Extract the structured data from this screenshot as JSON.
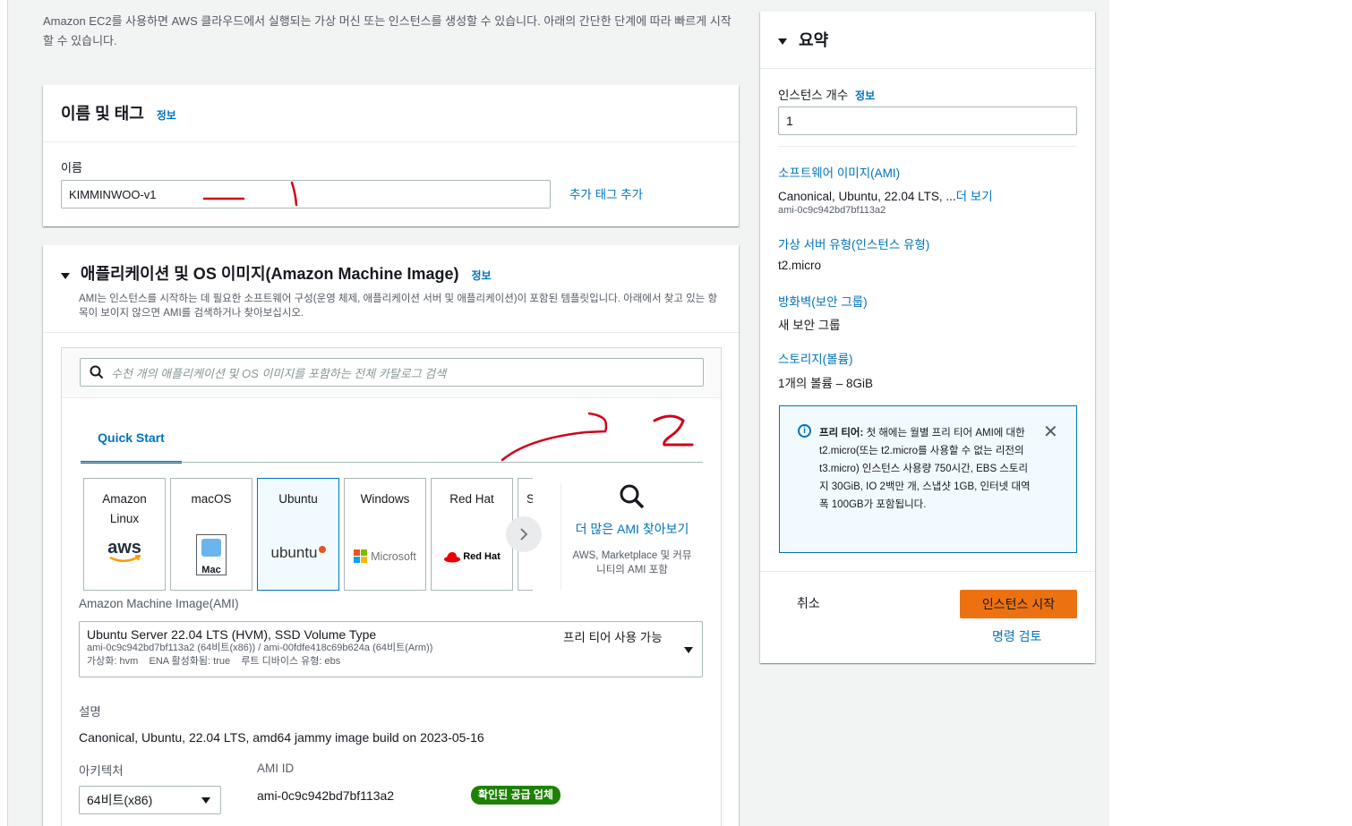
{
  "page": {
    "description": "Amazon EC2를 사용하면 AWS 클라우드에서 실행되는 가상 머신 또는 인스턴스를 생성할 수 있습니다. 아래의 간단한 단계에 따라 빠르게 시작할 수 있습니다."
  },
  "name_tags": {
    "title": "이름 및 태그",
    "info": "정보",
    "name_label": "이름",
    "name_value": "KIMMINWOO-v1",
    "add_tag": "추가 태그 추가"
  },
  "ami": {
    "title": "애플리케이션 및 OS 이미지(Amazon Machine Image)",
    "info": "정보",
    "description": "AMI는 인스턴스를 시작하는 데 필요한 소프트웨어 구성(운영 체제, 애플리케이션 서버 및 애플리케이션)이 포함된 템플릿입니다. 아래에서 찾고 있는 항목이 보이지 않으면 AMI를 검색하거나 찾아보십시오.",
    "search_placeholder": "수천 개의 애플리케이션 및 OS 이미지를 포함하는 전체 카탈로그 검색",
    "tab": "Quick Start",
    "os_cards": [
      {
        "label": "Amazon Linux",
        "logo": "aws"
      },
      {
        "label": "macOS",
        "logo": "Mac"
      },
      {
        "label": "Ubuntu",
        "logo": "ubuntu"
      },
      {
        "label": "Windows",
        "logo": "Microsoft"
      },
      {
        "label": "Red Hat",
        "logo": "Red Hat"
      },
      {
        "label": "S"
      }
    ],
    "more_title": "더 많은 AMI 찾아보기",
    "more_sub": "AWS, Marketplace 및 커뮤니티의 AMI 포함",
    "ami_label": "Amazon Machine Image(AMI)",
    "selected_name": "Ubuntu Server 22.04 LTS (HVM), SSD Volume Type",
    "selected_free": "프리 티어 사용 가능",
    "selected_ids": "ami-0c9c942bd7bf113a2 (64비트(x86)) / ami-00fdfe418c69b624a (64비트(Arm))",
    "selected_meta": "가상화: hvm    ENA 활성화됨: true    루트 디바이스 유형: ebs",
    "desc_label": "설명",
    "desc_value": "Canonical, Ubuntu, 22.04 LTS, amd64 jammy image build on 2023-05-16",
    "arch_label": "아키텍처",
    "arch_value": "64비트(x86)",
    "ami_id_label": "AMI ID",
    "ami_id_value": "ami-0c9c942bd7bf113a2",
    "verified_badge": "확인된 공급 업체"
  },
  "summary": {
    "title": "요약",
    "count_label": "인스턴스 개수",
    "info": "정보",
    "count_value": "1",
    "software_image_label": "소프트웨어 이미지(AMI)",
    "software_image_value": "Canonical, Ubuntu, 22.04 LTS, ...",
    "more_link": "더 보기",
    "software_image_id": "ami-0c9c942bd7bf113a2",
    "instance_type_label": "가상 서버 유형(인스턴스 유형)",
    "instance_type_value": "t2.micro",
    "firewall_label": "방화벽(보안 그룹)",
    "firewall_value": "새 보안 그룹",
    "storage_label": "스토리지(볼륨)",
    "storage_value": "1개의 볼륨 – 8GiB",
    "free_tier_text_bold": "프리 티어:",
    "free_tier_text": "첫 해에는 월별 프리 티어 AMI에 대한 t2.micro(또는 t2.micro를 사용할 수 없는 리전의 t3.micro) 인스턴스 사용량 750시간, EBS 스토리지 30GiB, IO 2백만 개, 스냅샷 1GB, 인터넷 대역폭 100GB가 포함됩니다.",
    "cancel": "취소",
    "launch": "인스턴스 시작",
    "review": "명령 검토"
  },
  "colors": {
    "link": "#0073bb",
    "launch_button": "#ec7211",
    "badge": "#1d8102",
    "annotation": "#d0021b"
  }
}
